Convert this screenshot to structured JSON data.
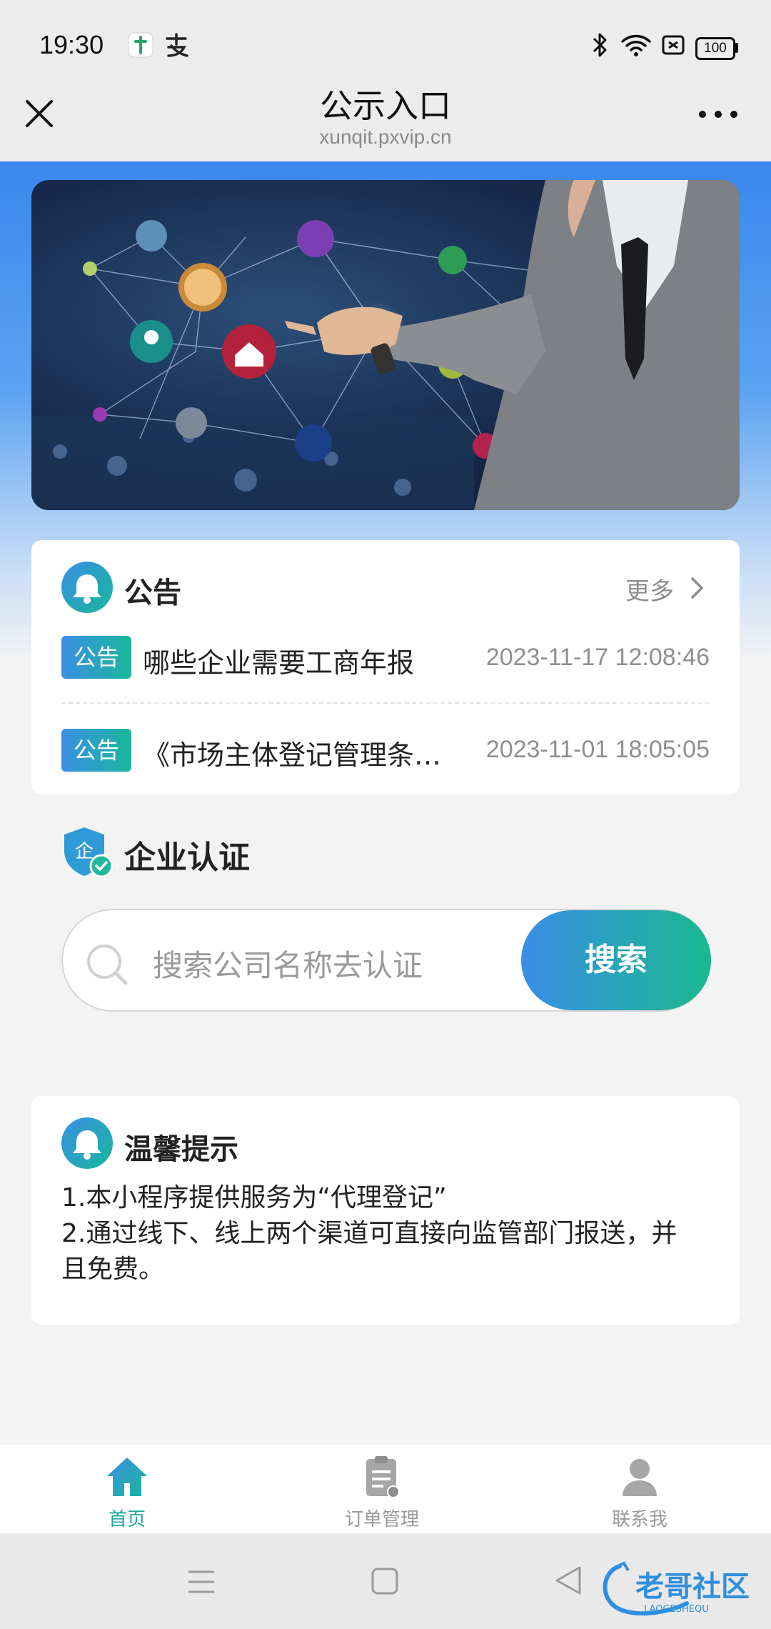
{
  "status_bar": {
    "time": "19:30",
    "battery": "100",
    "icons": [
      "app-notification-icon",
      "alipay-icon",
      "bluetooth-icon",
      "wifi-icon",
      "sim-icon",
      "battery-icon"
    ]
  },
  "nav": {
    "title": "公示入口",
    "url": "xunqit.pxvip.cn",
    "close_icon": "close-icon",
    "more_icon": "more-icon"
  },
  "notice": {
    "title": "公告",
    "more_label": "更多",
    "items": [
      {
        "tag": "公告",
        "title": "哪些企业需要工商年报",
        "time": "2023-11-17 12:08:46"
      },
      {
        "tag": "公告",
        "title": "《市场主体登记管理条…",
        "time": "2023-11-01 18:05:05"
      }
    ]
  },
  "enterprise": {
    "title": "企业认证",
    "shield_char": "企",
    "search_placeholder": "搜索公司名称去认证",
    "search_button": "搜索"
  },
  "tips": {
    "title": "温馨提示",
    "line1": "1.本小程序提供服务为“代理登记”",
    "line2": "2.通过线下、线上两个渠道可直接向监管部门报送，并",
    "line3": "且免费。"
  },
  "tabs": [
    {
      "label": "首页",
      "icon": "home-icon",
      "active": true
    },
    {
      "label": "订单管理",
      "icon": "clipboard-icon",
      "active": false
    },
    {
      "label": "联系我",
      "icon": "user-icon",
      "active": false
    }
  ],
  "watermark": {
    "text": "老哥社区",
    "sub": "LAOGESHEQU"
  },
  "colors": {
    "accent_blue": "#3a8fe6",
    "accent_green": "#19b79a",
    "active_tab": "#1aa7a0",
    "inactive_tab": "#9a9a9a"
  }
}
